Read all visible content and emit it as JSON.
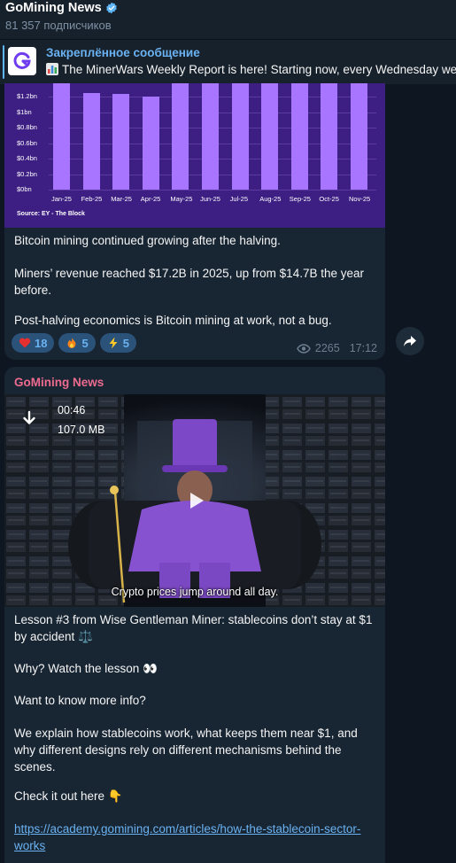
{
  "channel": {
    "title": "GoMining News",
    "subscribers": "81 357 подписчиков"
  },
  "pinned": {
    "label": "Закреплённое сообщение",
    "text": "The MinerWars Weekly Report is here!  Starting now, every Wednesday we’ll"
  },
  "post1": {
    "chart_data": {
      "type": "bar",
      "categories": [
        "Jan-25",
        "Feb-25",
        "Mar-25",
        "Apr-25",
        "May-25",
        "Jun-25",
        "Jul-25",
        "Aug-25",
        "Sep-25",
        "Oct-25",
        "Nov-25"
      ],
      "values": [
        1.45,
        1.25,
        1.23,
        1.2,
        1.45,
        1.45,
        1.45,
        1.45,
        1.45,
        1.45,
        1.45
      ],
      "y_ticks": [
        "$0bn",
        "$0.2bn",
        "$0.4bn",
        "$0.6bn",
        "$0.8bn",
        "$1bn",
        "$1.2bn"
      ],
      "ylim": [
        0,
        1.4
      ],
      "source": "Source: EY - The Block"
    },
    "paragraphs": [
      "Bitcoin mining continued growing after the halving.",
      "Miners’ revenue reached $17.2B in 2025, up from $14.7B the year before.",
      "Post-halving economics is Bitcoin mining at work, not a bug."
    ],
    "reactions": [
      {
        "icon": "heart-icon",
        "count": "18"
      },
      {
        "icon": "fire-icon",
        "count": "5"
      },
      {
        "icon": "lightning-icon",
        "count": "5"
      }
    ],
    "views": "2265",
    "time": "17:12"
  },
  "post2": {
    "sender": "GoMining News",
    "video": {
      "duration": "00:46",
      "size": "107.0 MB",
      "caption": "Crypto prices jump around all day."
    },
    "paragraphs": [
      "Lesson #3 from Wise Gentleman Miner: stablecoins don’t stay at $1 by accident ⚖️",
      "Why? Watch the lesson 👀",
      "Want to know more info?",
      "We explain how stablecoins work, what keeps them near $1, and why different designs rely on different mechanisms behind the scenes.",
      "Check it out here 👇"
    ],
    "link": "https://academy.gomining.com/articles/how-the-stablecoin-sector-works"
  },
  "colors": {
    "background": "#0e1621",
    "bubble": "#182533",
    "accent": "#6ab2f2",
    "sender": "#ed6b8e",
    "chart_bar": "#a775ff",
    "chart_bg": "#3d1e82"
  }
}
